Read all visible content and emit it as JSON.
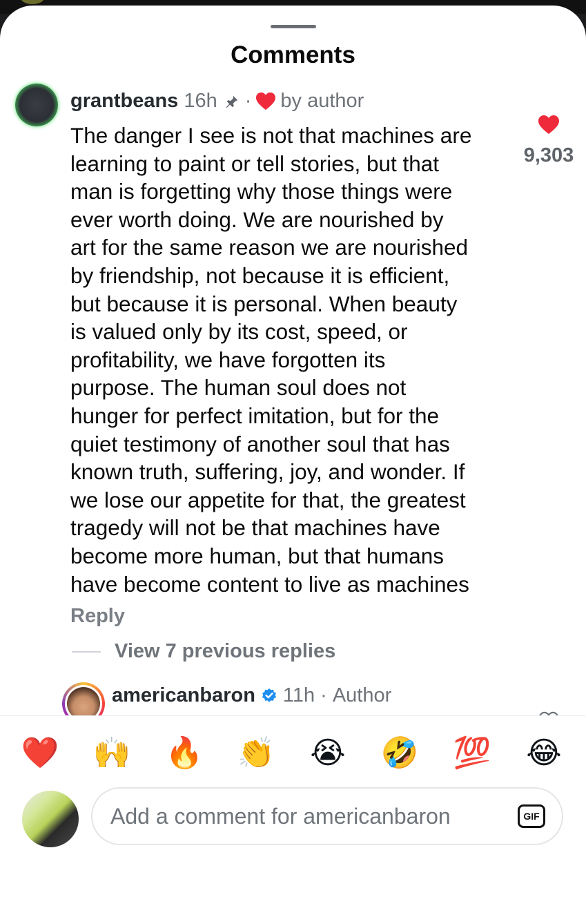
{
  "sheet": {
    "title": "Comments"
  },
  "comment": {
    "username": "grantbeans",
    "time": "16h",
    "separator": "·",
    "liked_by": "by author",
    "body_lines": [
      "The danger I see is not that machines are",
      "learning to paint or tell stories, but that",
      "man is forgetting why those things were",
      "ever worth doing. We are nourished by",
      "art for the same reason we are nourished",
      "by friendship, not because it is efficient,",
      "but because it is personal. When beauty",
      "is valued only by its cost, speed, or",
      "profitability, we have forgotten its",
      "purpose. The human soul does not",
      "hunger for perfect imitation, but for the",
      "quiet testimony of another soul that has",
      "known truth, suffering, joy, and wonder. If",
      "we lose our appetite for that, the greatest",
      "tragedy will not be that machines have",
      "become more human, but that humans",
      "have become content to live as machines"
    ],
    "like_count": "9,303",
    "reply_label": "Reply",
    "view_replies_label": "View 7 previous replies"
  },
  "reply": {
    "username": "americanbaron",
    "time": "11h",
    "separator": "·",
    "role": "Author"
  },
  "emoji_bar": [
    "❤️",
    "🙌",
    "🔥",
    "👏",
    "😭",
    "🤣",
    "💯",
    "😂"
  ],
  "composer": {
    "placeholder": "Add a comment for americanbaron",
    "gif_label": "GIF"
  },
  "colors": {
    "heart": "#ee2a3b",
    "verified": "#1d8ef0",
    "online_ring": "#53e06a"
  }
}
